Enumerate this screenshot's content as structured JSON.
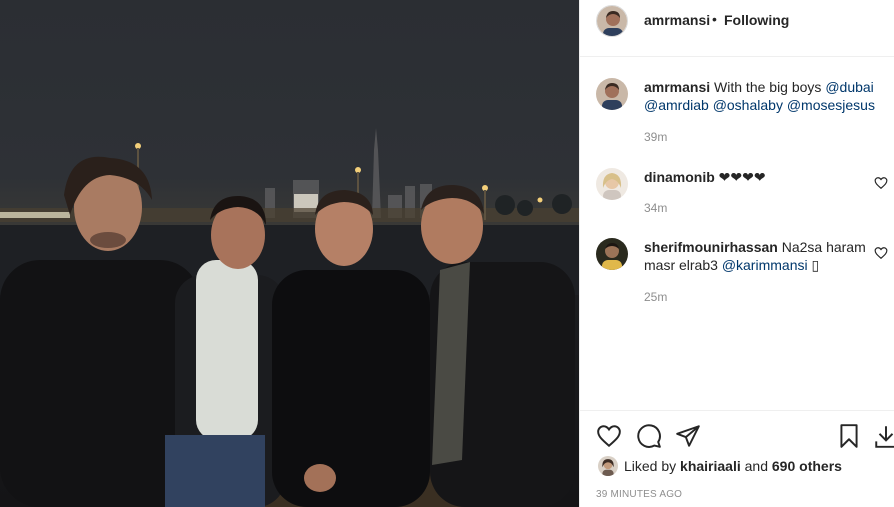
{
  "header": {
    "username": "amrmansi",
    "separator": "•",
    "follow_status": "Following"
  },
  "caption": {
    "username": "amrmansi",
    "text": "With the big boys",
    "mentions": [
      "@dubai",
      "@amrdiab",
      "@oshalaby",
      "@mosesjesus"
    ],
    "time": "39m"
  },
  "comments": [
    {
      "username": "dinamonib",
      "text": "❤❤❤❤",
      "time": "34m"
    },
    {
      "username": "sherifmounirhassan",
      "text": "Na2sa haram masr elrab3",
      "mention": "@karimmansi",
      "trailing": "▯",
      "time": "25m"
    }
  ],
  "actions": {
    "icons": [
      "heart-icon",
      "comment-icon",
      "share-icon",
      "bookmark-icon",
      "download-icon"
    ]
  },
  "likes": {
    "prefix": "Liked by",
    "user": "khairiaali",
    "conj": "and",
    "others": "690 others"
  },
  "posted_ago": "39 MINUTES AGO",
  "colors": {
    "link": "#00376b",
    "muted": "#8e8e8e",
    "text": "#262626",
    "border": "#efefef"
  }
}
